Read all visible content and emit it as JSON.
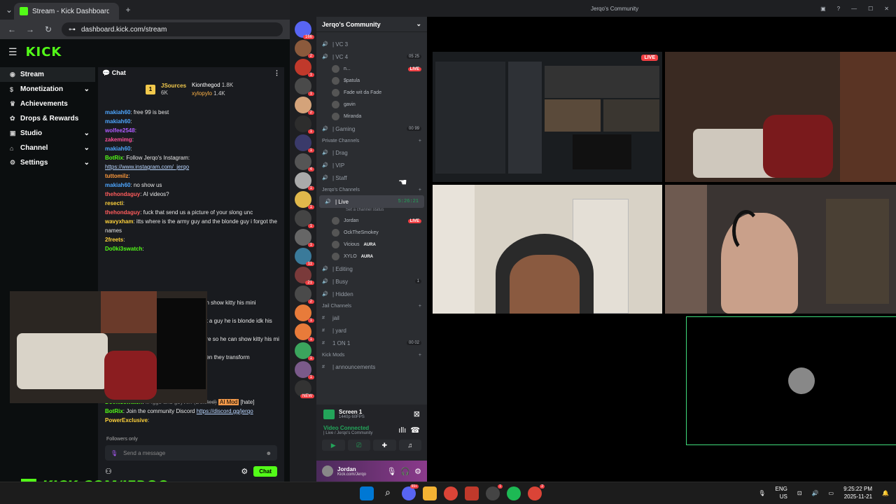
{
  "browser": {
    "tab_title": "Stream - Kick Dashboard",
    "url": "dashboard.kick.com/stream"
  },
  "kick": {
    "logo": "KICK",
    "nav": [
      {
        "label": "Stream",
        "icon": "broadcast-icon",
        "active": true,
        "expand": false
      },
      {
        "label": "Monetization",
        "icon": "dollar-icon",
        "active": false,
        "expand": true
      },
      {
        "label": "Achievements",
        "icon": "trophy-icon",
        "active": false,
        "expand": false
      },
      {
        "label": "Drops & Rewards",
        "icon": "gift-icon",
        "active": false,
        "expand": false
      },
      {
        "label": "Studio",
        "icon": "studio-icon",
        "active": false,
        "expand": true
      },
      {
        "label": "Channel",
        "icon": "channel-icon",
        "active": false,
        "expand": true
      },
      {
        "label": "Settings",
        "icon": "gear-icon",
        "active": false,
        "expand": true
      }
    ],
    "chat": {
      "title": "Chat",
      "leaderboard": {
        "rank": "1",
        "first_name": "JSources",
        "first_count": "6K",
        "second_name": "Kionthegod",
        "second_count": "1.8K",
        "third_name": "xylopylo",
        "third_count": "1.4K"
      },
      "messages": [
        {
          "user": "makiah60",
          "color": "#4ea6ff",
          "text": "free 99 is best"
        },
        {
          "user": "makiah60",
          "color": "#4ea6ff",
          "text": ""
        },
        {
          "user": "wolfee2548",
          "color": "#b05cff",
          "text": ""
        },
        {
          "user": "zakemimg",
          "color": "#ff4f9a",
          "text": ""
        },
        {
          "user": "makiah60",
          "color": "#4ea6ff",
          "text": ""
        },
        {
          "user": "BotRix",
          "color": "#53fc18",
          "text": "Follow Jerqo's Instagram:"
        },
        {
          "user": "",
          "color": "#fff",
          "text": "",
          "link": "https://www.instagram.com/_jerqo"
        },
        {
          "user": "tuttomilz",
          "color": "#ff9a3c",
          "text": ""
        },
        {
          "user": "makiah60",
          "color": "#4ea6ff",
          "text": "no show us"
        },
        {
          "user": "thehondaguy",
          "color": "#ff5c5c",
          "text": "AI videos?"
        },
        {
          "user": "resecti",
          "color": "#ffd23c",
          "text": ""
        },
        {
          "user": "thehondaguy",
          "color": "#ff5c5c",
          "text": "fuck that send us a picture of your slong unc"
        },
        {
          "user": "wavyxham",
          "color": "#ffd23c",
          "text": "itts where is the army guy and the blonde guy i forgot their"
        },
        {
          "user": "",
          "color": "#fff",
          "text": "names"
        },
        {
          "user": "2freets",
          "color": "#ffd23c",
          "text": ""
        },
        {
          "user": "Do0ki3swatch",
          "color": "#53fc18",
          "text": ""
        }
      ],
      "partial_lines": [
        "an show kitty his mini",
        "ut a guy he is blonde idk his",
        "ere so he can show kitty his mi",
        "hen they transform"
      ],
      "mod_label": "AI Mod",
      "hate_label": "[hate]",
      "deleted_line_user": "Do0ki3swatch",
      "deleted_line_text": "lil4gg8 and g3yven (Deleted)",
      "bot_discord_text": "Join the community Discord",
      "bot_discord_link": "https://discord.gg/jerqo",
      "last_user": "PowerExclusive",
      "followers_only": "Followers only",
      "input_placeholder": "Send a message",
      "send_label": "Chat"
    },
    "banner": "KICK.COM/JERQO"
  },
  "discord": {
    "window_title": "Jerqo's Community",
    "server_name": "Jerqo's Community",
    "server_badges": [
      "166",
      "2",
      "1",
      "1",
      "2",
      "1",
      "1",
      "4",
      "1",
      "1",
      "1",
      "1",
      "11",
      "21",
      "2",
      "1",
      "1",
      "1",
      "1",
      "NEW"
    ],
    "channels_top": [
      {
        "name": "| VC 3",
        "right": "",
        "type": "voice"
      },
      {
        "name": "| VC 4",
        "right": "05 25",
        "type": "voice"
      }
    ],
    "vc4_users": [
      {
        "name": "n...",
        "tag": "LIVE"
      },
      {
        "name": "$patula",
        "tag": ""
      },
      {
        "name": "Fade wit da Fade",
        "tag": ""
      },
      {
        "name": "gavin",
        "tag": ""
      },
      {
        "name": "Miranda",
        "tag": ""
      }
    ],
    "gaming": {
      "name": "| Gaming",
      "count": "00 99"
    },
    "private_cat": "Private Channels",
    "private": [
      "| Drag",
      "| VIP",
      "| Staff"
    ],
    "jerqo_cat": "Jerqo's Channels",
    "live_channel": {
      "name": "| Live",
      "time": "5:26:21",
      "status": "Set a channel status"
    },
    "live_users": [
      {
        "name": "Jordan",
        "tag": "LIVE"
      },
      {
        "name": "OckTheSmokey",
        "tag": ""
      },
      {
        "name": "Vicious",
        "tag": "AURA"
      },
      {
        "name": "XYLO",
        "tag": "AURA"
      }
    ],
    "more_channels": [
      {
        "name": "| Editing",
        "right": ""
      },
      {
        "name": "| Busy",
        "right": "1"
      },
      {
        "name": "| Hidden",
        "right": ""
      }
    ],
    "jail_cat": "Jail Channels",
    "jail": [
      {
        "name": "jail",
        "right": ""
      },
      {
        "name": "| yard",
        "right": ""
      },
      {
        "name": "1 ON 1",
        "right": "00 02"
      }
    ],
    "mods_cat": "Kick Mods",
    "announcements": "| announcements",
    "screen": {
      "title": "Screen 1",
      "sub": "1440p 60FPS"
    },
    "video": {
      "status": "Video Connected",
      "sub": "| Live / Jerqo's Community"
    },
    "user": {
      "name": "Jordan",
      "sub": "Kick.com/Jerqo"
    },
    "live_tag": "LIVE"
  },
  "taskbar": {
    "lang": "ENG",
    "region": "US",
    "time": "9:25:22 PM",
    "date": "2025-11-21"
  }
}
